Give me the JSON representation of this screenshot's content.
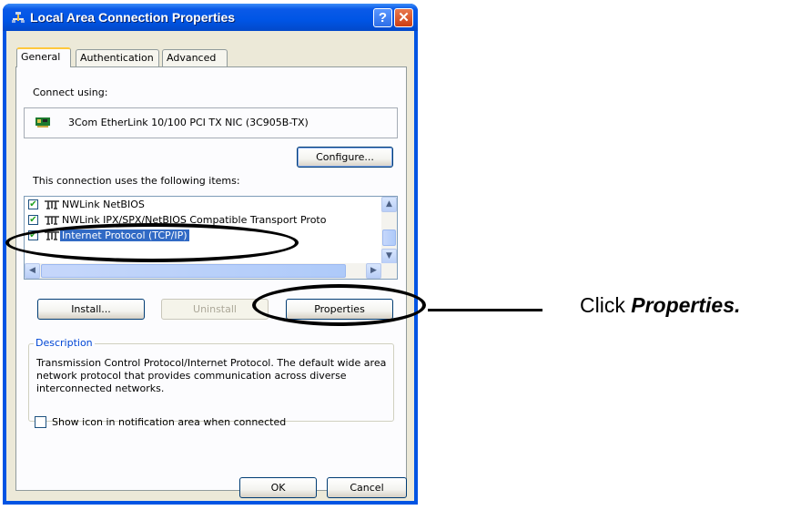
{
  "window": {
    "title": "Local Area Connection Properties",
    "help_glyph": "?",
    "close_glyph": "✕"
  },
  "tabs": [
    {
      "label": "General",
      "active": true
    },
    {
      "label": "Authentication",
      "active": false
    },
    {
      "label": "Advanced",
      "active": false
    }
  ],
  "connect_using": {
    "label": "Connect using:",
    "adapter": "3Com EtherLink 10/100 PCI TX NIC (3C905B-TX)"
  },
  "buttons": {
    "configure": "Configure...",
    "install": "Install...",
    "uninstall": "Uninstall",
    "properties": "Properties",
    "ok": "OK",
    "cancel": "Cancel"
  },
  "items_label": "This connection uses the following items:",
  "items": [
    {
      "label": "NWLink NetBIOS",
      "checked": true,
      "selected": false
    },
    {
      "label": "NWLink IPX/SPX/NetBIOS Compatible Transport Proto",
      "checked": true,
      "selected": false
    },
    {
      "label": "Internet Protocol (TCP/IP)",
      "checked": true,
      "selected": true
    }
  ],
  "description": {
    "legend": "Description",
    "text": "Transmission Control Protocol/Internet Protocol. The default wide area network protocol that provides communication across diverse interconnected networks."
  },
  "show_icon": {
    "label": "Show icon in notification area when connected",
    "checked": false
  },
  "annotation": {
    "prefix": "Click ",
    "emphasis": "Properties."
  },
  "colors": {
    "titlebar": "#0054e3",
    "selection": "#316ac5",
    "dialog_bg": "#ece9d8"
  }
}
